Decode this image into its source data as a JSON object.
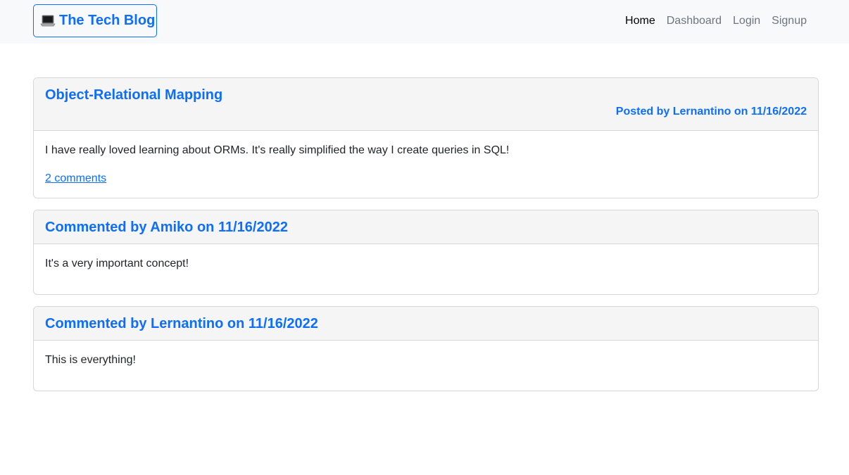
{
  "navbar": {
    "brand_icon": "laptop-icon",
    "brand_label": "The Tech Blog",
    "links": [
      {
        "label": "Home",
        "active": true
      },
      {
        "label": "Dashboard",
        "active": false
      },
      {
        "label": "Login",
        "active": false
      },
      {
        "label": "Signup",
        "active": false
      }
    ]
  },
  "post": {
    "title": "Object-Relational Mapping",
    "meta": "Posted by Lernantino on 11/16/2022",
    "content": "I have really loved learning about ORMs. It's really simplified the way I create queries in SQL!",
    "comments_link": "2 comments"
  },
  "comments": [
    {
      "header": "Commented by Amiko on 11/16/2022",
      "text": "It's a very important concept!"
    },
    {
      "header": "Commented by Lernantino on 11/16/2022",
      "text": "This is everything!"
    }
  ],
  "colors": {
    "accent": "#0d6efd",
    "navbar_bg": "#f8f9fa",
    "card_header_bg": "#f5f5f5"
  }
}
